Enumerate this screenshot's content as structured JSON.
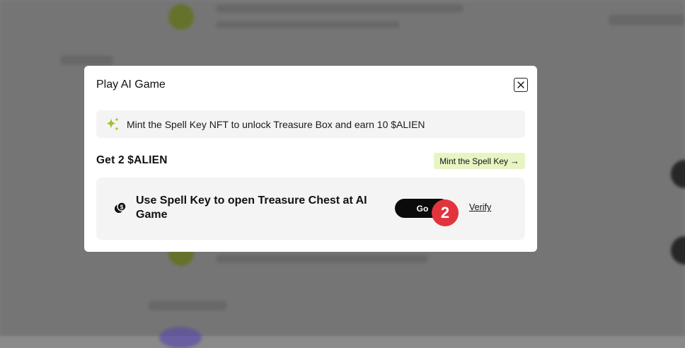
{
  "modal": {
    "title": "Play AI Game",
    "close_icon": "close-icon",
    "banner": {
      "icon": "sparkle-icon",
      "text": "Mint the Spell Key NFT to unlock Treasure Box and earn 10 $ALIEN"
    },
    "reward_title": "Get 2 $ALIEN",
    "mint_link": {
      "label": "Mint the Spell Key",
      "icon": "arrow-right-icon"
    },
    "task": {
      "icon": "coins-icon",
      "text": "Use Spell Key to open Treasure Chest at AI Game",
      "go_label": "Go",
      "step_number": "2",
      "verify_label": "Verify"
    }
  },
  "colors": {
    "accent_green": "#9bc52a",
    "mint_bg": "#e7f5c4",
    "badge_red": "#e2343d",
    "button_black": "#0b0b0b"
  }
}
